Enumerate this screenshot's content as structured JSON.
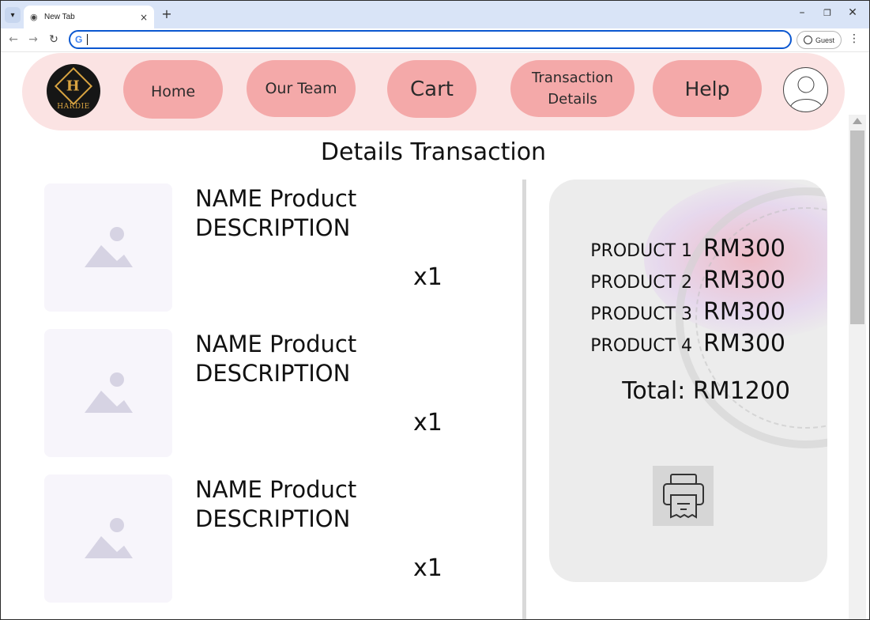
{
  "browser": {
    "tab_title": "New Tab",
    "tab_close": "×",
    "new_tab": "+",
    "omnibox_value": "",
    "omnibox_icon": "G",
    "profile_label": "Guest",
    "icons": [
      "tab-search-icon",
      "globe-icon",
      "back-icon",
      "forward-icon",
      "reload-icon",
      "google-icon",
      "profile-icon",
      "menu-icon",
      "minimize-icon",
      "restore-icon",
      "close-icon"
    ]
  },
  "nav": {
    "logo_letter": "H",
    "logo_text": "HARDIE",
    "items": [
      {
        "label": "Home"
      },
      {
        "label": "Our Team"
      },
      {
        "label": "Cart"
      },
      {
        "label": "Transaction Details"
      },
      {
        "label": "Help"
      }
    ],
    "avatar_icon": "user-avatar-icon"
  },
  "page": {
    "title": "Details Transaction"
  },
  "products": [
    {
      "name": "NAME Product",
      "description": "DESCRIPTION",
      "qty": "x1",
      "image_icon": "image-placeholder-icon"
    },
    {
      "name": "NAME Product",
      "description": "DESCRIPTION",
      "qty": "x1",
      "image_icon": "image-placeholder-icon"
    },
    {
      "name": "NAME Product",
      "description": "DESCRIPTION",
      "qty": "x1",
      "image_icon": "image-placeholder-icon"
    }
  ],
  "summary": {
    "lines": [
      {
        "label": "PRODUCT 1",
        "price": "RM300"
      },
      {
        "label": "PRODUCT 2",
        "price": "RM300"
      },
      {
        "label": "PRODUCT 3",
        "price": "RM300"
      },
      {
        "label": "PRODUCT 4",
        "price": "RM300"
      }
    ],
    "total": "Total: RM1200",
    "print_icon": "printer-icon"
  },
  "colors": {
    "navbar_bg": "#fbe3e3",
    "pill_bg": "#f4a9a9",
    "card_bg": "#ececec",
    "omnibox_border": "#0b57d0",
    "tabbar_bg": "#d9e4f7"
  }
}
